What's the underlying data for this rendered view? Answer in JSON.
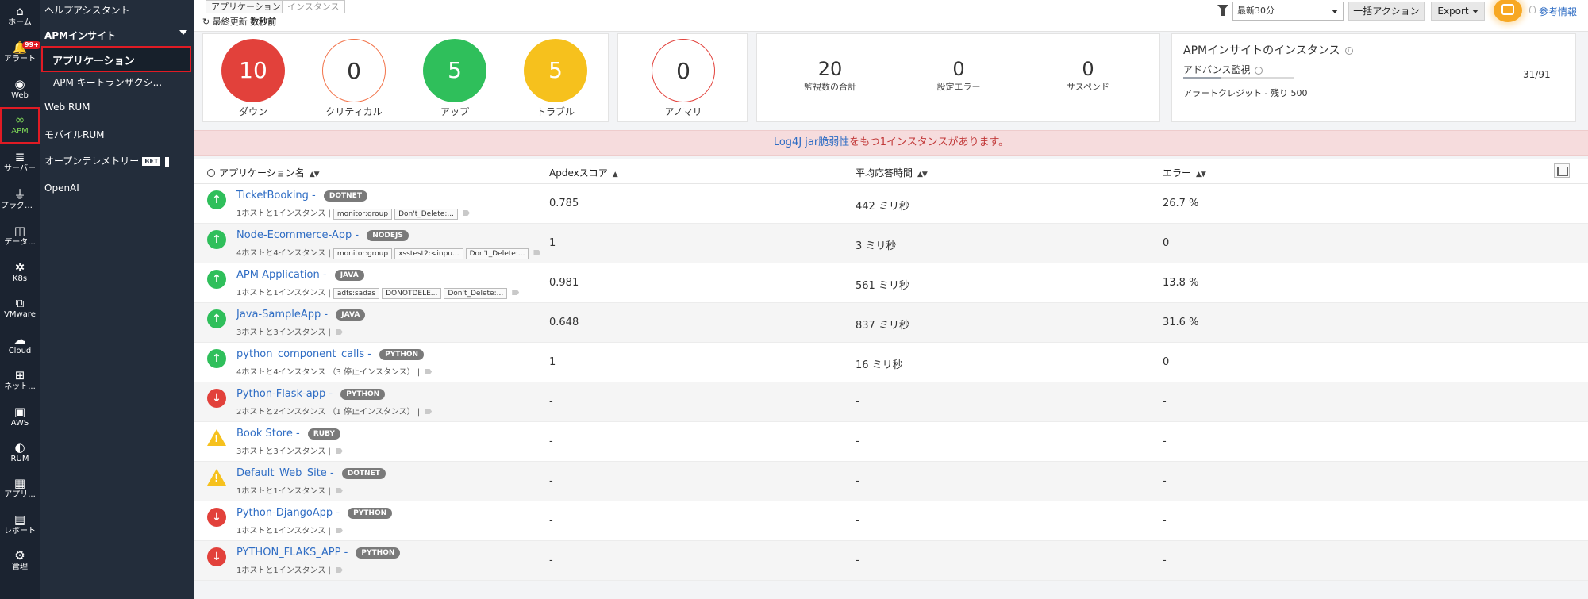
{
  "rail": {
    "items": [
      {
        "glyph": "⌂",
        "label": "ホーム",
        "icon": "home-icon"
      },
      {
        "glyph": "🔔",
        "label": "アラート",
        "icon": "bell-icon",
        "badge": "99+"
      },
      {
        "glyph": "◉",
        "label": "Web",
        "icon": "globe-icon"
      },
      {
        "glyph": "∞",
        "label": "APM",
        "icon": "binoculars-icon",
        "active": true
      },
      {
        "glyph": "≣",
        "label": "サーバー",
        "icon": "server-icon"
      },
      {
        "glyph": "⏚",
        "label": "プラグイン",
        "icon": "plug-icon"
      },
      {
        "glyph": "◫",
        "label": "データ...",
        "icon": "database-icon"
      },
      {
        "glyph": "✲",
        "label": "K8s",
        "icon": "k8s-icon"
      },
      {
        "glyph": "⧉",
        "label": "VMware",
        "icon": "vmware-icon"
      },
      {
        "glyph": "☁",
        "label": "Cloud",
        "icon": "cloud-icon"
      },
      {
        "glyph": "⊞",
        "label": "ネット...",
        "icon": "network-icon"
      },
      {
        "glyph": "▣",
        "label": "AWS",
        "icon": "aws-icon"
      },
      {
        "glyph": "◐",
        "label": "RUM",
        "icon": "rum-icon"
      },
      {
        "glyph": "▦",
        "label": "アプリ...",
        "icon": "apps-icon"
      },
      {
        "glyph": "▤",
        "label": "レポート",
        "icon": "report-icon"
      },
      {
        "glyph": "⚙",
        "label": "管理",
        "icon": "gear-icon"
      }
    ]
  },
  "subnav": {
    "help": "ヘルプアシスタント",
    "apm_insight": "APMインサイト",
    "applications": "アプリケーション",
    "key_txn": "APM キートランザクシ...",
    "web_rum": "Web RUM",
    "mobile_rum": "モバイルRUM",
    "otel": "オープンテレメトリー",
    "otel_badge": "BET",
    "openai": "OpenAI"
  },
  "topbar": {
    "tab_app": "アプリケーション",
    "tab_instance": "インスタンス",
    "last_updated_label": "最終更新",
    "last_updated_value": "数秒前",
    "time_range": "最新30分",
    "bulk_action": "一括アクション",
    "export": "Export",
    "reference": "参考情報"
  },
  "summary": {
    "down": {
      "value": "10",
      "label": "ダウン",
      "color": "#e2413b"
    },
    "critical": {
      "value": "0",
      "label": "クリティカル",
      "color": "#f2734a"
    },
    "up": {
      "value": "5",
      "label": "アップ",
      "color": "#2fbf5b"
    },
    "trouble": {
      "value": "5",
      "label": "トラブル",
      "color": "#f6c11d"
    },
    "anomaly": {
      "value": "0",
      "label": "アノマリ",
      "color": "#e2413b"
    },
    "total": {
      "value": "20",
      "label": "監視数の合計"
    },
    "config_error": {
      "value": "0",
      "label": "設定エラー"
    },
    "suspend": {
      "value": "0",
      "label": "サスペンド"
    },
    "instances": {
      "title": "APMインサイトのインスタンス",
      "advanced": "アドバンス監視",
      "count": "31/91",
      "used_fraction": 0.34,
      "credit": "アラートクレジット - 残り 500"
    }
  },
  "banner": {
    "link": "Log4J jar脆弱性",
    "text": "をもつ1インスタンスがあります。"
  },
  "table": {
    "columns": {
      "name": "アプリケーション名",
      "apdex": "Apdexスコア",
      "resp": "平均応答時間",
      "error": "エラー"
    },
    "rows": [
      {
        "status": "up",
        "name": "TicketBooking",
        "tag": "DOTNET",
        "meta": "1ホストと1インスタンス |",
        "chips": [
          "monitor:group",
          "Don't_Delete:..."
        ],
        "apdex": "0.785",
        "resp": "442 ミリ秒",
        "error": "26.7 %"
      },
      {
        "status": "up",
        "name": "Node-Ecommerce-App",
        "tag": "NODEJS",
        "meta": "4ホストと4インスタンス |",
        "chips": [
          "monitor:group",
          "xsstest2:<inpu...",
          "Don't_Delete:..."
        ],
        "apdex": "1",
        "resp": "3 ミリ秒",
        "error": "0"
      },
      {
        "status": "up",
        "name": "APM Application",
        "tag": "JAVA",
        "meta": "1ホストと1インスタンス |",
        "chips": [
          "adfs:sadas",
          "DONOTDELE...",
          "Don't_Delete:..."
        ],
        "apdex": "0.981",
        "resp": "561 ミリ秒",
        "error": "13.8 %"
      },
      {
        "status": "up",
        "name": "Java-SampleApp",
        "tag": "JAVA",
        "meta": "3ホストと3インスタンス |",
        "chips": [],
        "apdex": "0.648",
        "resp": "837 ミリ秒",
        "error": "31.6 %"
      },
      {
        "status": "up",
        "name": "python_component_calls",
        "tag": "PYTHON",
        "meta": "4ホストと4インスタンス （3 停止インスタンス） |",
        "chips": [],
        "apdex": "1",
        "resp": "16 ミリ秒",
        "error": "0"
      },
      {
        "status": "down",
        "name": "Python-Flask-app",
        "tag": "PYTHON",
        "meta": "2ホストと2インスタンス （1 停止インスタンス） |",
        "chips": [],
        "apdex": "-",
        "resp": "-",
        "error": "-"
      },
      {
        "status": "trouble",
        "name": "Book Store",
        "tag": "RUBY",
        "meta": "3ホストと3インスタンス |",
        "chips": [],
        "apdex": "-",
        "resp": "-",
        "error": "-"
      },
      {
        "status": "trouble",
        "name": "Default_Web_Site",
        "tag": "DOTNET",
        "meta": "1ホストと1インスタンス |",
        "chips": [],
        "apdex": "-",
        "resp": "-",
        "error": "-"
      },
      {
        "status": "down",
        "name": "Python-DjangoApp",
        "tag": "PYTHON",
        "meta": "1ホストと1インスタンス |",
        "chips": [],
        "apdex": "-",
        "resp": "-",
        "error": "-"
      },
      {
        "status": "down",
        "name": "PYTHON_FLAKS_APP",
        "tag": "PYTHON",
        "meta": "1ホストと1インスタンス |",
        "chips": [],
        "apdex": "-",
        "resp": "-",
        "error": "-"
      }
    ]
  }
}
